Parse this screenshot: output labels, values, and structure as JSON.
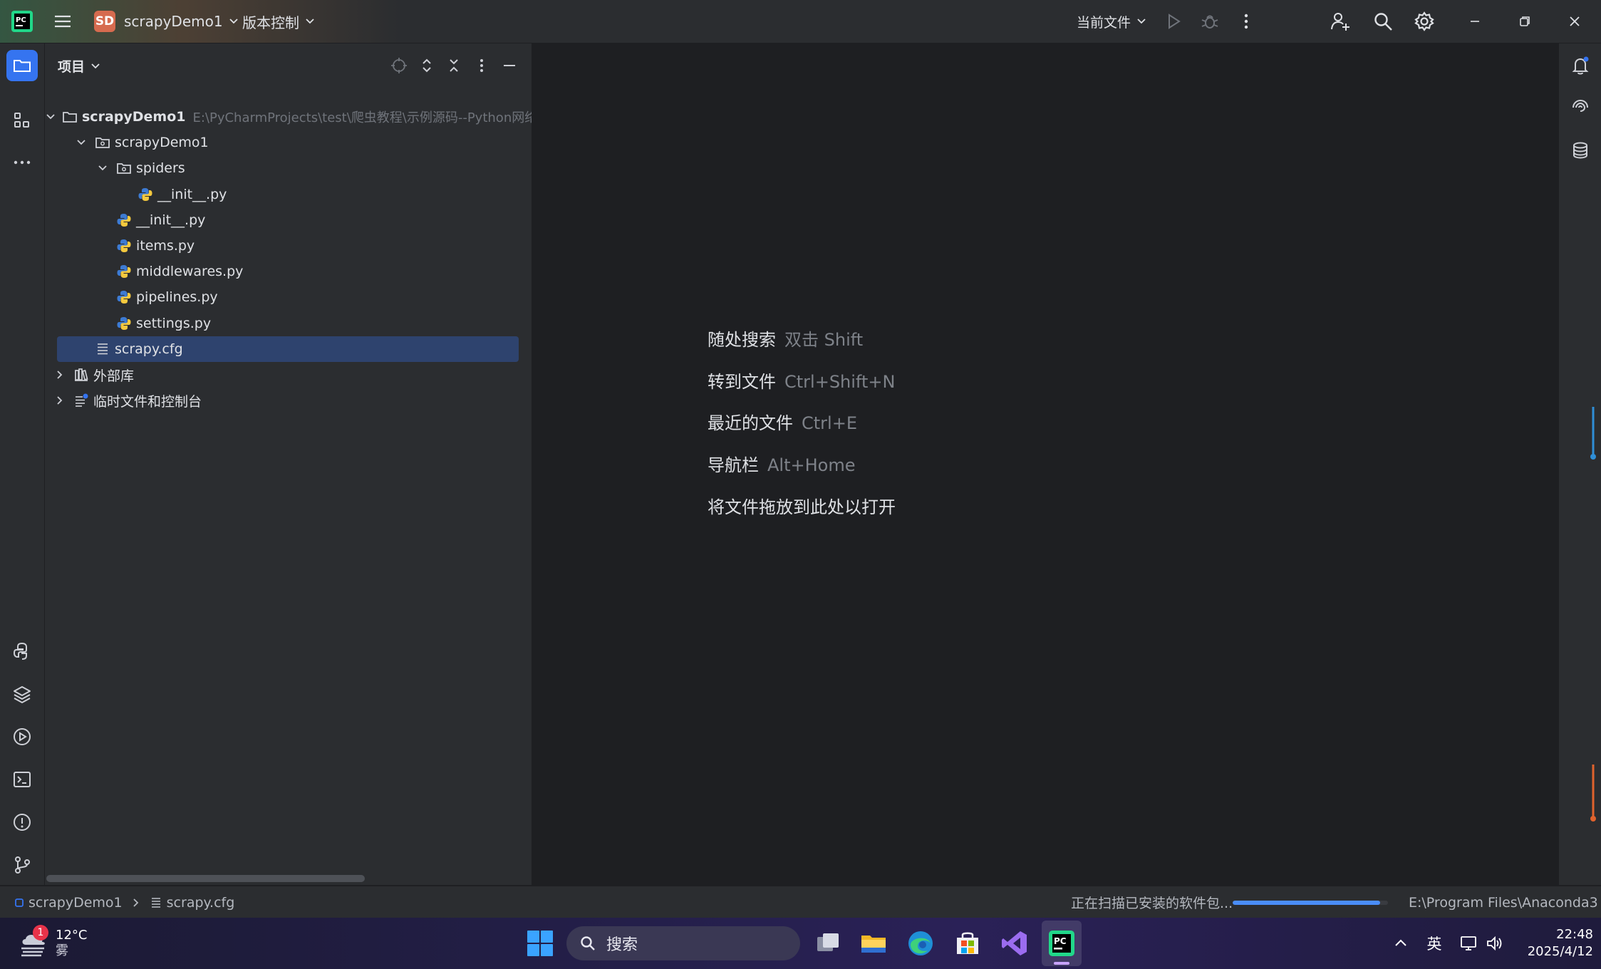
{
  "titlebar": {
    "project_badge": "SD",
    "project_name": "scrapyDemo1",
    "vcs_label": "版本控制",
    "run_config": "当前文件"
  },
  "left_strip": {
    "items": [
      "project-icon",
      "structure-icon",
      "more-icon",
      "python-console-icon",
      "layers-icon",
      "run-icon",
      "terminal-icon",
      "problems-icon",
      "git-icon"
    ]
  },
  "project_panel": {
    "title": "项目",
    "tree": [
      {
        "label": "scrapyDemo1",
        "hint": "E:\\PyCharmProjects\\test\\爬虫教程\\示例源码--Python网络",
        "type": "root-folder",
        "expanded": true,
        "depth": 0
      },
      {
        "label": "scrapyDemo1",
        "type": "package",
        "expanded": true,
        "depth": 1
      },
      {
        "label": "spiders",
        "type": "package",
        "expanded": true,
        "depth": 2
      },
      {
        "label": "__init__.py",
        "type": "python",
        "depth": 3
      },
      {
        "label": "__init__.py",
        "type": "python",
        "depth": 2
      },
      {
        "label": "items.py",
        "type": "python",
        "depth": 2
      },
      {
        "label": "middlewares.py",
        "type": "python",
        "depth": 2
      },
      {
        "label": "pipelines.py",
        "type": "python",
        "depth": 2
      },
      {
        "label": "settings.py",
        "type": "python",
        "depth": 2
      },
      {
        "label": "scrapy.cfg",
        "type": "text",
        "depth": 1,
        "selected": true
      },
      {
        "label": "外部库",
        "type": "library",
        "expanded": false,
        "depth": 0
      },
      {
        "label": "临时文件和控制台",
        "type": "scratch",
        "expanded": false,
        "depth": 0
      }
    ]
  },
  "editor": {
    "hints": [
      {
        "action": "随处搜索",
        "key": "双击 Shift"
      },
      {
        "action": "转到文件",
        "key": "Ctrl+Shift+N"
      },
      {
        "action": "最近的文件",
        "key": "Ctrl+E"
      },
      {
        "action": "导航栏",
        "key": "Alt+Home"
      },
      {
        "action": "将文件拖放到此处以打开",
        "key": ""
      }
    ]
  },
  "statusbar": {
    "breadcrumb_project": "scrapyDemo1",
    "breadcrumb_file": "scrapy.cfg",
    "task_text": "正在扫描已安装的软件包...",
    "progress": 0.95,
    "interpreter": "E:\\Program Files\\Anaconda3"
  },
  "taskbar": {
    "weather_temp": "12°C",
    "weather_desc": "雾",
    "weather_badge": "1",
    "search_placeholder": "搜索",
    "lang": "英",
    "time": "22:48",
    "date": "2025/4/12"
  },
  "colors": {
    "accent": "#3574f0",
    "selection": "#2e436e",
    "background": "#1e1f22",
    "panel": "#2b2d30"
  }
}
